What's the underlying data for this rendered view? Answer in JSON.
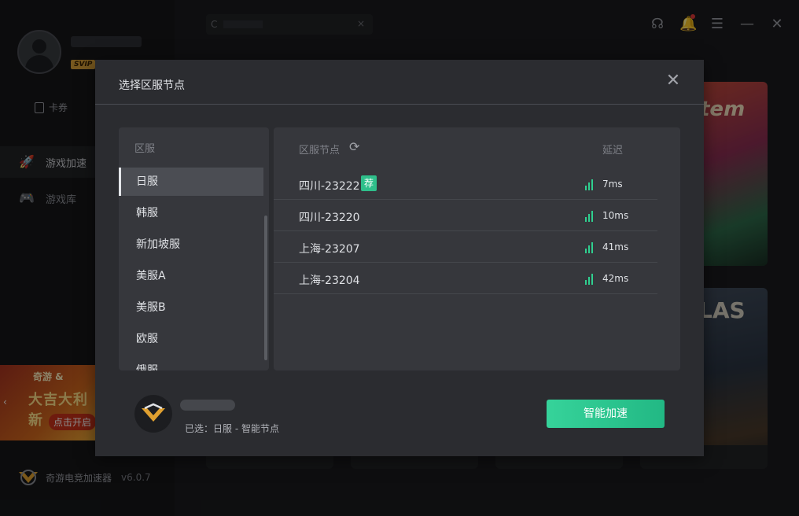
{
  "app": {
    "name": "奇游电竞加速器",
    "version": "v6.0.7",
    "vip_badge": "SVIP",
    "coupon_label": "卡券",
    "nav": [
      {
        "label": "游戏加速",
        "icon": "rocket-icon",
        "active": true
      },
      {
        "label": "游戏库",
        "icon": "gamepad-icon",
        "active": false
      }
    ],
    "banner": {
      "line1": "奇游 &",
      "line2": "大吉大利新",
      "cta": "点击开启"
    },
    "game_cards": [
      {
        "title": "tem"
      },
      {
        "title": "LAS"
      }
    ]
  },
  "modal": {
    "title": "选择区服节点",
    "region_header": "区服",
    "regions": [
      {
        "label": "日服",
        "selected": true
      },
      {
        "label": "韩服",
        "selected": false
      },
      {
        "label": "新加坡服",
        "selected": false
      },
      {
        "label": "美服A",
        "selected": false
      },
      {
        "label": "美服B",
        "selected": false
      },
      {
        "label": "欧服",
        "selected": false
      },
      {
        "label": "俄服",
        "selected": false
      }
    ],
    "node_header": "区服节点",
    "latency_header": "延迟",
    "nodes": [
      {
        "name": "四川-23222",
        "badge": "荐",
        "latency": "7ms"
      },
      {
        "name": "四川-23220",
        "badge": "",
        "latency": "10ms"
      },
      {
        "name": "上海-23207",
        "badge": "",
        "latency": "41ms"
      },
      {
        "name": "上海-23204",
        "badge": "",
        "latency": "42ms"
      }
    ],
    "selected_text": "已选：日服 - 智能节点",
    "accelerate_button": "智能加速"
  },
  "colors": {
    "accent": "#2fbf8b",
    "modal_bg": "#2b2c30",
    "panel_bg": "#36373c"
  }
}
